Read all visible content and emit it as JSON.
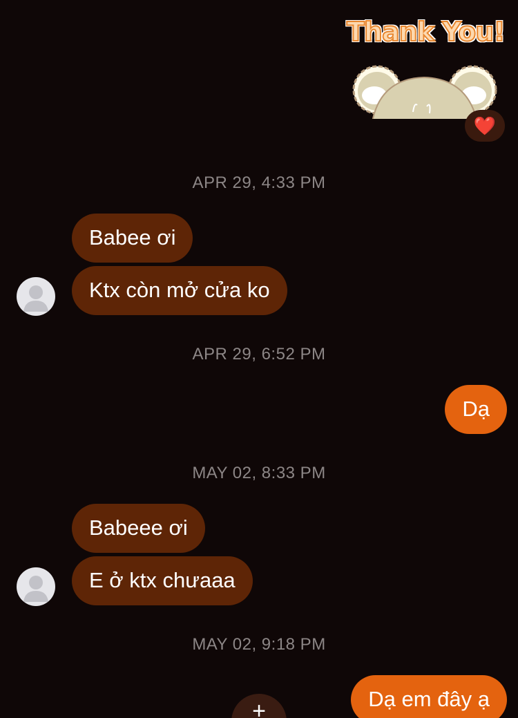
{
  "sticker": {
    "text": "Thank You!",
    "reaction": "❤️"
  },
  "messages": [
    {
      "type": "timestamp",
      "text": "APR 29, 4:33 PM"
    },
    {
      "type": "incoming",
      "text": "Babee ơi"
    },
    {
      "type": "incoming",
      "text": "Ktx còn mở cửa ko"
    },
    {
      "type": "timestamp",
      "text": "APR 29, 6:52 PM"
    },
    {
      "type": "outgoing",
      "text": "Dạ"
    },
    {
      "type": "timestamp",
      "text": "MAY 02, 8:33 PM"
    },
    {
      "type": "incoming",
      "text": "Babeee ơi"
    },
    {
      "type": "incoming",
      "text": "E ở ktx chưaaa"
    },
    {
      "type": "timestamp",
      "text": "MAY 02, 9:18 PM"
    },
    {
      "type": "outgoing",
      "text": "Dạ em đây ạ"
    }
  ],
  "add_button": "+",
  "icons": {
    "avatar": "default-avatar-icon",
    "reaction": "heart-icon",
    "sticker": "bear-sticker-icon",
    "add": "plus-icon"
  },
  "colors": {
    "background": "#0f0707",
    "incoming_bubble": "#5e2506",
    "outgoing_bubble": "#e4630f",
    "timestamp": "#8c8686"
  }
}
